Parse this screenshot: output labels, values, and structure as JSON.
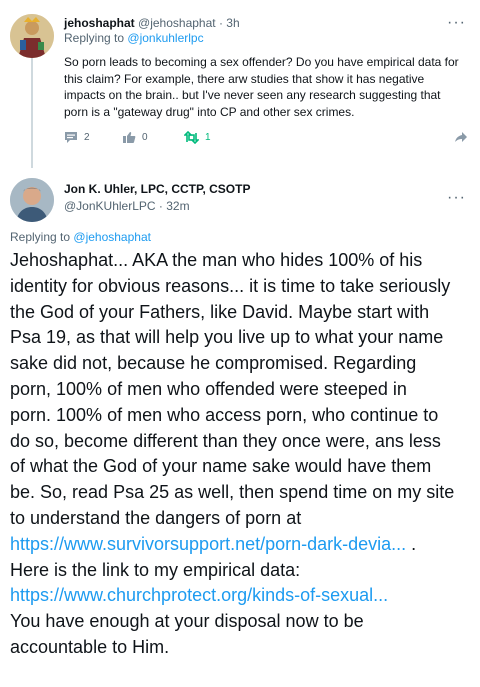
{
  "reply1": {
    "name": "jehoshaphat",
    "handle": "@jehoshaphat",
    "dot": "·",
    "time": "3h",
    "replying_prefix": "Replying to",
    "replying_to": "@jonkuhlerlpc",
    "body": "So porn leads to becoming a sex offender? Do you have empirical data for this claim? For example, there arw studies that show it has negative impacts on the brain.. but I've never seen any research suggesting that porn is a \"gateway drug\" into CP and other sex crimes.",
    "actions": {
      "replies": "2",
      "likes": "0",
      "retweets": "1"
    }
  },
  "reply2": {
    "name": "Jon K. Uhler, LPC, CCTP, CSOTP",
    "handle": "@JonKUhlerLPC",
    "dot": "·",
    "time": "32m",
    "replying_prefix": "Replying to",
    "replying_to": "@jehoshaphat",
    "lines": [
      "Jehoshaphat... AKA the man who hides 100% of his",
      "identity for obvious reasons... it is time to take seriously",
      "the God of your Fathers, like David. Maybe start with",
      "Psa 19, as that will help you live up to what your name",
      "sake did not, because he compromised. Regarding",
      "porn, 100% of men who offended were steeped in",
      "porn. 100% of men who access porn, who continue to",
      "do so, become different than they once were, ans less",
      "of what the God of your name sake would have them",
      "be. So, read Psa 25 as well, then spend time on my site",
      "to understand the dangers of porn at"
    ],
    "link1": "https://www.survivorsupport.net/porn-dark-devia...",
    "link1_suffix": " .",
    "line_after_link1": "Here is the link to my empirical data:",
    "link2": "https://www.churchprotect.org/kinds-of-sexual...",
    "closing_lines": [
      "You have enough at your disposal now to be",
      "accountable to Him."
    ]
  },
  "icons": {
    "more": "more-icon",
    "reply": "reply-icon",
    "like": "like-icon",
    "retweet": "retweet-icon",
    "share": "share-icon"
  },
  "colors": {
    "link": "#1d9bf0",
    "secondary_text": "#536471",
    "retweet_green": "#00ba7c"
  }
}
